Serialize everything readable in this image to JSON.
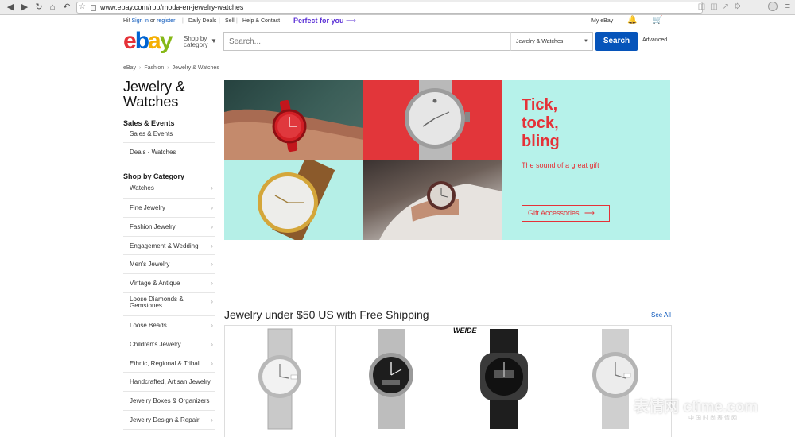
{
  "browser": {
    "url": "www.ebay.com/rpp/moda-en-jewelry-watches"
  },
  "global_header": {
    "greeting": "Hi!",
    "sign_in": "Sign in",
    "or": "or",
    "register": "register",
    "daily_deals": "Daily Deals",
    "sell": "Sell",
    "help": "Help & Contact",
    "perfect": "Perfect for you",
    "my_ebay": "My eBay"
  },
  "search": {
    "logo_letters": [
      "e",
      "b",
      "a",
      "y"
    ],
    "shop_by": "Shop by",
    "category": "category",
    "placeholder": "Search...",
    "category_selected": "Jewelry & Watches",
    "button": "Search",
    "advanced": "Advanced"
  },
  "breadcrumb": [
    "eBay",
    "Fashion",
    "Jewelry & Watches"
  ],
  "left_nav": {
    "title_line1": "Jewelry &",
    "title_line2": "Watches",
    "sales_heading": "Sales & Events",
    "sales_items": [
      "Sales & Events",
      "Deals - Watches"
    ],
    "category_heading": "Shop by Category",
    "categories": [
      "Watches",
      "Fine Jewelry",
      "Fashion Jewelry",
      "Engagement & Wedding",
      "Men's Jewelry",
      "Vintage & Antique",
      "Loose Diamonds & Gemstones",
      "Loose Beads",
      "Children's Jewelry",
      "Ethnic, Regional & Tribal",
      "Handcrafted, Artisan Jewelry",
      "Jewelry Boxes & Organizers",
      "Jewelry Design & Repair"
    ]
  },
  "hero": {
    "line1": "Tick,",
    "line2": "tock,",
    "line3": "bling",
    "subtitle": "The sound of a great gift",
    "cta": "Gift Accessories"
  },
  "deals_section": {
    "title": "Jewelry under $50 US with Free Shipping",
    "see_all": "See All",
    "brand_label": "WEIDE"
  },
  "watermark": {
    "main": "表情网 ctime.com",
    "sub": "中国时尚表情网"
  },
  "colors": {
    "ebay_red": "#e53238",
    "ebay_blue": "#0064d2",
    "ebay_yellow": "#f5af02",
    "ebay_green": "#86b817",
    "search_button": "#0654ba",
    "hero_mint": "#b6f2ea",
    "perfect_purple": "#5d33d6"
  }
}
